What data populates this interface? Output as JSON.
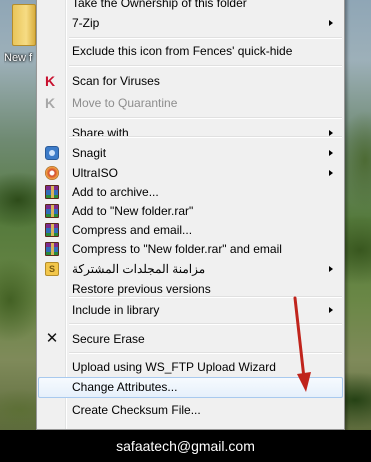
{
  "desktop": {
    "icon_label": "New f"
  },
  "menu": {
    "items": [
      {
        "label": "Take the Ownership of this folder",
        "icon": "",
        "submenu": false,
        "disabled": false
      },
      {
        "label": "7-Zip",
        "icon": "",
        "submenu": true,
        "disabled": false
      },
      {
        "label": "Exclude this icon from Fences' quick-hide",
        "icon": "",
        "submenu": false,
        "disabled": false
      },
      {
        "label": "Scan for Viruses",
        "icon": "kaspersky-icon",
        "submenu": false,
        "disabled": false
      },
      {
        "label": "Move to Quarantine",
        "icon": "kaspersky-gray-icon",
        "submenu": false,
        "disabled": true
      },
      {
        "label": "Share with",
        "icon": "",
        "submenu": true,
        "disabled": false
      },
      {
        "label": "Snagit",
        "icon": "snagit-icon",
        "submenu": true,
        "disabled": false
      },
      {
        "label": "UltraISO",
        "icon": "ultraiso-icon",
        "submenu": true,
        "disabled": false
      },
      {
        "label": "Add to archive...",
        "icon": "winrar-icon",
        "submenu": false,
        "disabled": false
      },
      {
        "label": "Add to \"New folder.rar\"",
        "icon": "winrar-icon",
        "submenu": false,
        "disabled": false
      },
      {
        "label": "Compress and email...",
        "icon": "winrar-icon",
        "submenu": false,
        "disabled": false
      },
      {
        "label": "Compress to \"New folder.rar\" and email",
        "icon": "winrar-icon",
        "submenu": false,
        "disabled": false
      },
      {
        "label": "مزامنة المجلدات المشتركة",
        "icon": "sync-icon",
        "submenu": true,
        "disabled": false
      },
      {
        "label": "Restore previous versions",
        "icon": "",
        "submenu": false,
        "disabled": false
      },
      {
        "label": "Include in library",
        "icon": "",
        "submenu": true,
        "disabled": false
      },
      {
        "label": "Secure Erase",
        "icon": "x-icon",
        "submenu": false,
        "disabled": false
      },
      {
        "label": "Upload using WS_FTP Upload Wizard",
        "icon": "",
        "submenu": false,
        "disabled": false
      },
      {
        "label": "Change Attributes...",
        "icon": "",
        "submenu": false,
        "disabled": false,
        "highlighted": true
      },
      {
        "label": "Create Checksum File...",
        "icon": "",
        "submenu": false,
        "disabled": false
      }
    ]
  },
  "footer": {
    "text": "safaatech@gmail.com"
  },
  "colors": {
    "highlight_border": "#a8c9ee",
    "annotation_arrow": "#c0241c",
    "kaspersky_red": "#c8102e"
  }
}
